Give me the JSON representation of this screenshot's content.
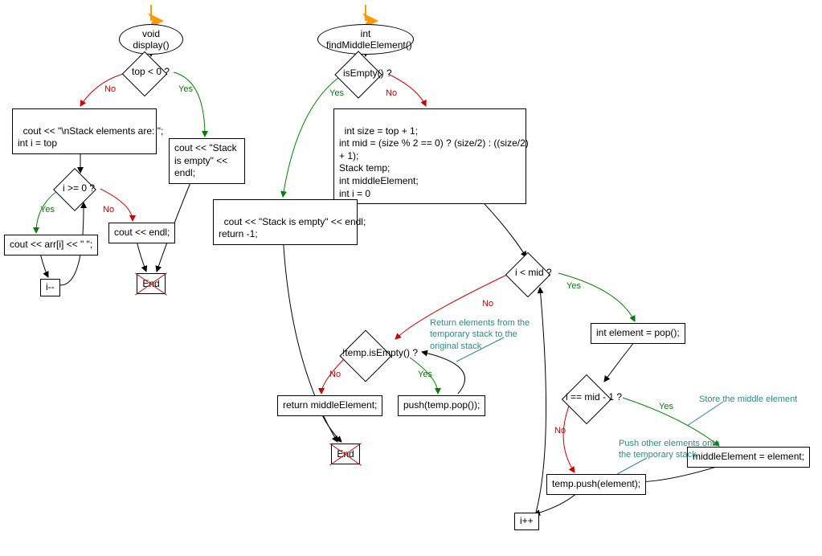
{
  "flowchart_left": {
    "start": "void display()",
    "decision_top": "top < 0 ?",
    "process_elements": "cout << \"\\nStack elements are: \";\nint i = top",
    "process_empty": "cout << \"Stack is empty\" << endl;",
    "decision_loop": "i >= 0 ?",
    "process_print": "cout << arr[i] << \" \";",
    "process_endl": "cout << endl;",
    "process_dec": "i--",
    "end": "End"
  },
  "flowchart_right": {
    "start": "int findMiddleElement()",
    "decision_empty": "isEmpty() ?",
    "process_empty": "cout << \"Stack is empty\" << endl;\nreturn -1;",
    "process_init": "int size = top + 1;\nint mid = (size % 2 == 0) ? (size/2) : ((size/2)\n+ 1);\nStack temp;\nint middleElement;\nint i = 0",
    "decision_imid": "i < mid ?",
    "process_pop": "int element = pop();",
    "decision_mid1": "i == mid - 1 ?",
    "process_store": "middleElement = element;",
    "process_push_temp": "temp.push(element);",
    "process_inc": "i++",
    "decision_tempempty": "!temp.isEmpty() ?",
    "process_return": "return middleElement;",
    "process_pushback": "push(temp.pop());",
    "end": "End",
    "comment_return": "Return elements from the\ntemporary stack to the\noriginal stack",
    "comment_store": "Store the middle element",
    "comment_pushtemp": "Push other elements onto\nthe temporary stack"
  },
  "labels": {
    "yes": "Yes",
    "no": "No"
  }
}
